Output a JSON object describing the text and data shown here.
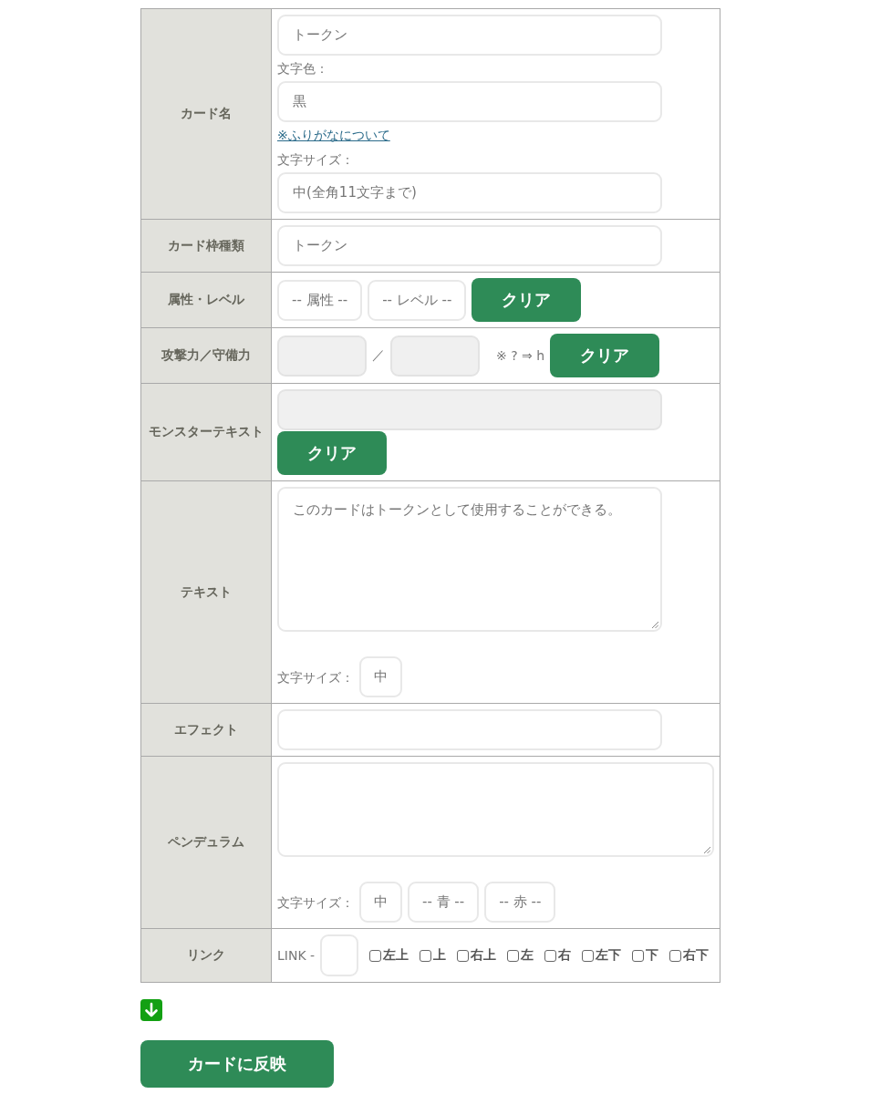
{
  "form": {
    "rows": [
      {
        "label": "カード名",
        "lines": [
          [
            {
              "kind": "input",
              "value": "トークン",
              "disabled": false
            }
          ],
          [
            {
              "kind": "label",
              "text": "文字色："
            }
          ],
          [
            {
              "kind": "select",
              "value": "黒"
            }
          ],
          [
            {
              "kind": "link",
              "text": "※ふりがなについて"
            }
          ],
          [
            {
              "kind": "label",
              "text": "文字サイズ："
            }
          ],
          [
            {
              "kind": "select",
              "value": "中(全角11文字まで)"
            }
          ]
        ]
      },
      {
        "label": "カード枠種類",
        "lines": [
          [
            {
              "kind": "select",
              "value": "トークン"
            }
          ]
        ]
      },
      {
        "label": "属性・レベル",
        "lines": [
          [
            {
              "kind": "dropdown",
              "value": "-- 属性 --"
            },
            {
              "kind": "dropdown",
              "value": "-- レベル --"
            },
            {
              "kind": "button",
              "label": "クリア"
            }
          ]
        ]
      },
      {
        "label": "攻撃力／守備力",
        "lines": [
          [
            {
              "kind": "short_input",
              "disabled": true
            },
            {
              "kind": "text",
              "text": "／"
            },
            {
              "kind": "short_input",
              "disabled": true
            },
            {
              "kind": "note",
              "text": "※ ? ⇒ h"
            },
            {
              "kind": "button",
              "label": "クリア"
            }
          ]
        ]
      },
      {
        "label": "モンスターテキスト",
        "lines": [
          [
            {
              "kind": "input",
              "disabled": true
            }
          ],
          [
            {
              "kind": "button",
              "label": "クリア"
            }
          ]
        ]
      },
      {
        "label": "テキスト",
        "lines": [
          [
            {
              "kind": "textarea",
              "value": "このカードはトークンとして使用することができる。"
            }
          ],
          [
            {
              "kind": "label",
              "text": "文字サイズ："
            },
            {
              "kind": "dropdown",
              "value": "中"
            }
          ]
        ]
      },
      {
        "label": "エフェクト",
        "lines": [
          [
            {
              "kind": "input",
              "disabled": false
            }
          ]
        ]
      },
      {
        "label": "ペンデュラム",
        "lines": [
          [
            {
              "kind": "wide_textarea"
            }
          ],
          [
            {
              "kind": "label",
              "text": "文字サイズ："
            },
            {
              "kind": "dropdown",
              "value": "中"
            },
            {
              "kind": "dropdown",
              "value": "-- 青 --"
            },
            {
              "kind": "dropdown",
              "value": "-- 赤 --"
            }
          ]
        ]
      },
      {
        "label": "リンク",
        "lines": [
          [
            {
              "kind": "text",
              "text": "LINK -"
            },
            {
              "kind": "tiny_input",
              "disabled": false
            },
            {
              "kind": "checkbox",
              "label": "左上",
              "checked": false
            },
            {
              "kind": "checkbox",
              "label": "上",
              "checked": false
            },
            {
              "kind": "checkbox",
              "label": "右上",
              "checked": false
            },
            {
              "kind": "checkbox",
              "label": "左",
              "checked": false
            },
            {
              "kind": "checkbox",
              "label": "右",
              "checked": false
            },
            {
              "kind": "checkbox",
              "label": "左下",
              "checked": false
            },
            {
              "kind": "checkbox",
              "label": "下",
              "checked": false
            },
            {
              "kind": "checkbox",
              "label": "右下",
              "checked": false
            }
          ]
        ]
      }
    ]
  },
  "submit_button": {
    "label": "カードに反映"
  }
}
